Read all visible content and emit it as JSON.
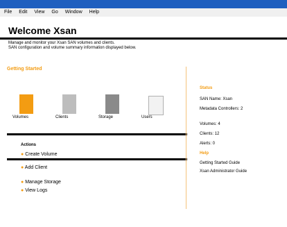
{
  "window": {
    "title": "Welcome Xsan",
    "titlebar_color": "#1f5fbf",
    "accent_orange": "#f39c12"
  },
  "menu": {
    "items": [
      "File",
      "Edit",
      "View",
      "Go",
      "Window",
      "Help"
    ]
  },
  "header": {
    "subtitle": "Manage and monitor your Xsan SAN volumes and clients.",
    "status_line": "SAN configuration and volume summary information displayed below."
  },
  "main": {
    "section_title": "Getting Started",
    "tiles": [
      {
        "label": "Volumes"
      },
      {
        "label": "Clients"
      },
      {
        "label": "Storage"
      },
      {
        "label": "Users"
      }
    ],
    "actions_title": "Actions",
    "actions": [
      {
        "label": "Create Volume"
      },
      {
        "label": "Add Client"
      },
      {
        "label": "Manage Storage"
      },
      {
        "label": "View Logs"
      }
    ]
  },
  "sidebar": {
    "title": "Status",
    "lines": [
      "SAN Name: Xsan",
      "Metadata Controllers: 2",
      "Volumes: 4",
      "Clients: 12",
      "Alerts: 0"
    ],
    "help_title": "Help",
    "help_lines": [
      "Getting Started Guide",
      "Xsan Administrator Guide"
    ]
  }
}
